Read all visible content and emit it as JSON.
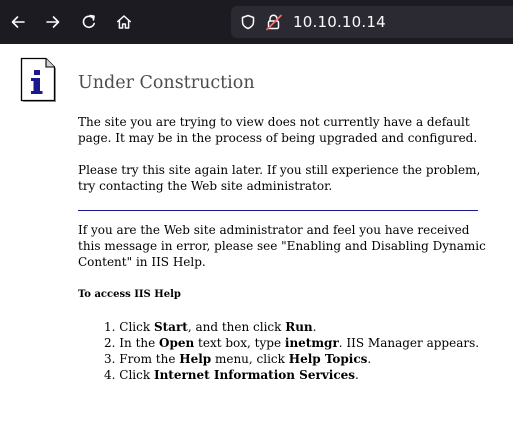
{
  "browser": {
    "url": "10.10.10.14",
    "back_icon": "arrow-left-icon",
    "forward_icon": "arrow-right-icon",
    "reload_icon": "reload-icon",
    "home_icon": "home-icon",
    "shield_icon": "shield-icon",
    "lock_icon": "insecure-lock-icon",
    "colors": {
      "toolbar_bg": "#1c1b22",
      "urlbar_bg": "#2b2a33",
      "url_text": "#fbfbfe",
      "lock_warning": "#ff6b6b"
    }
  },
  "page": {
    "icon": "info-icon",
    "title": "Under Construction",
    "paragraph1": "The site you are trying to view does not currently have a default page. It may be in the process of being upgraded and configured.",
    "paragraph2": "Please try this site again later. If you still experience the problem, try contacting the Web site administrator.",
    "paragraph3": "If you are the Web site administrator and feel you have received this message in error, please see \"Enabling and Disabling Dynamic Content\" in IIS Help.",
    "subheading": "To access IIS Help",
    "steps": [
      {
        "num": "1.",
        "pre": "Click ",
        "b1": "Start",
        "mid": ", and then click ",
        "b2": "Run",
        "post": "."
      },
      {
        "num": "2.",
        "pre": "In the ",
        "b1": "Open",
        "mid": " text box, type ",
        "b2": "inetmgr",
        "post": ". IIS Manager appears."
      },
      {
        "num": "3.",
        "pre": "From the ",
        "b1": "Help",
        "mid": " menu, click ",
        "b2": "Help Topics",
        "post": "."
      },
      {
        "num": "4.",
        "pre": "Click ",
        "b1": "Internet Information Services",
        "mid": "",
        "b2": "",
        "post": "."
      }
    ],
    "colors": {
      "title": "#4d4d4d",
      "divider": "#1a1a8c",
      "icon_blue": "#1a1a8c"
    }
  }
}
